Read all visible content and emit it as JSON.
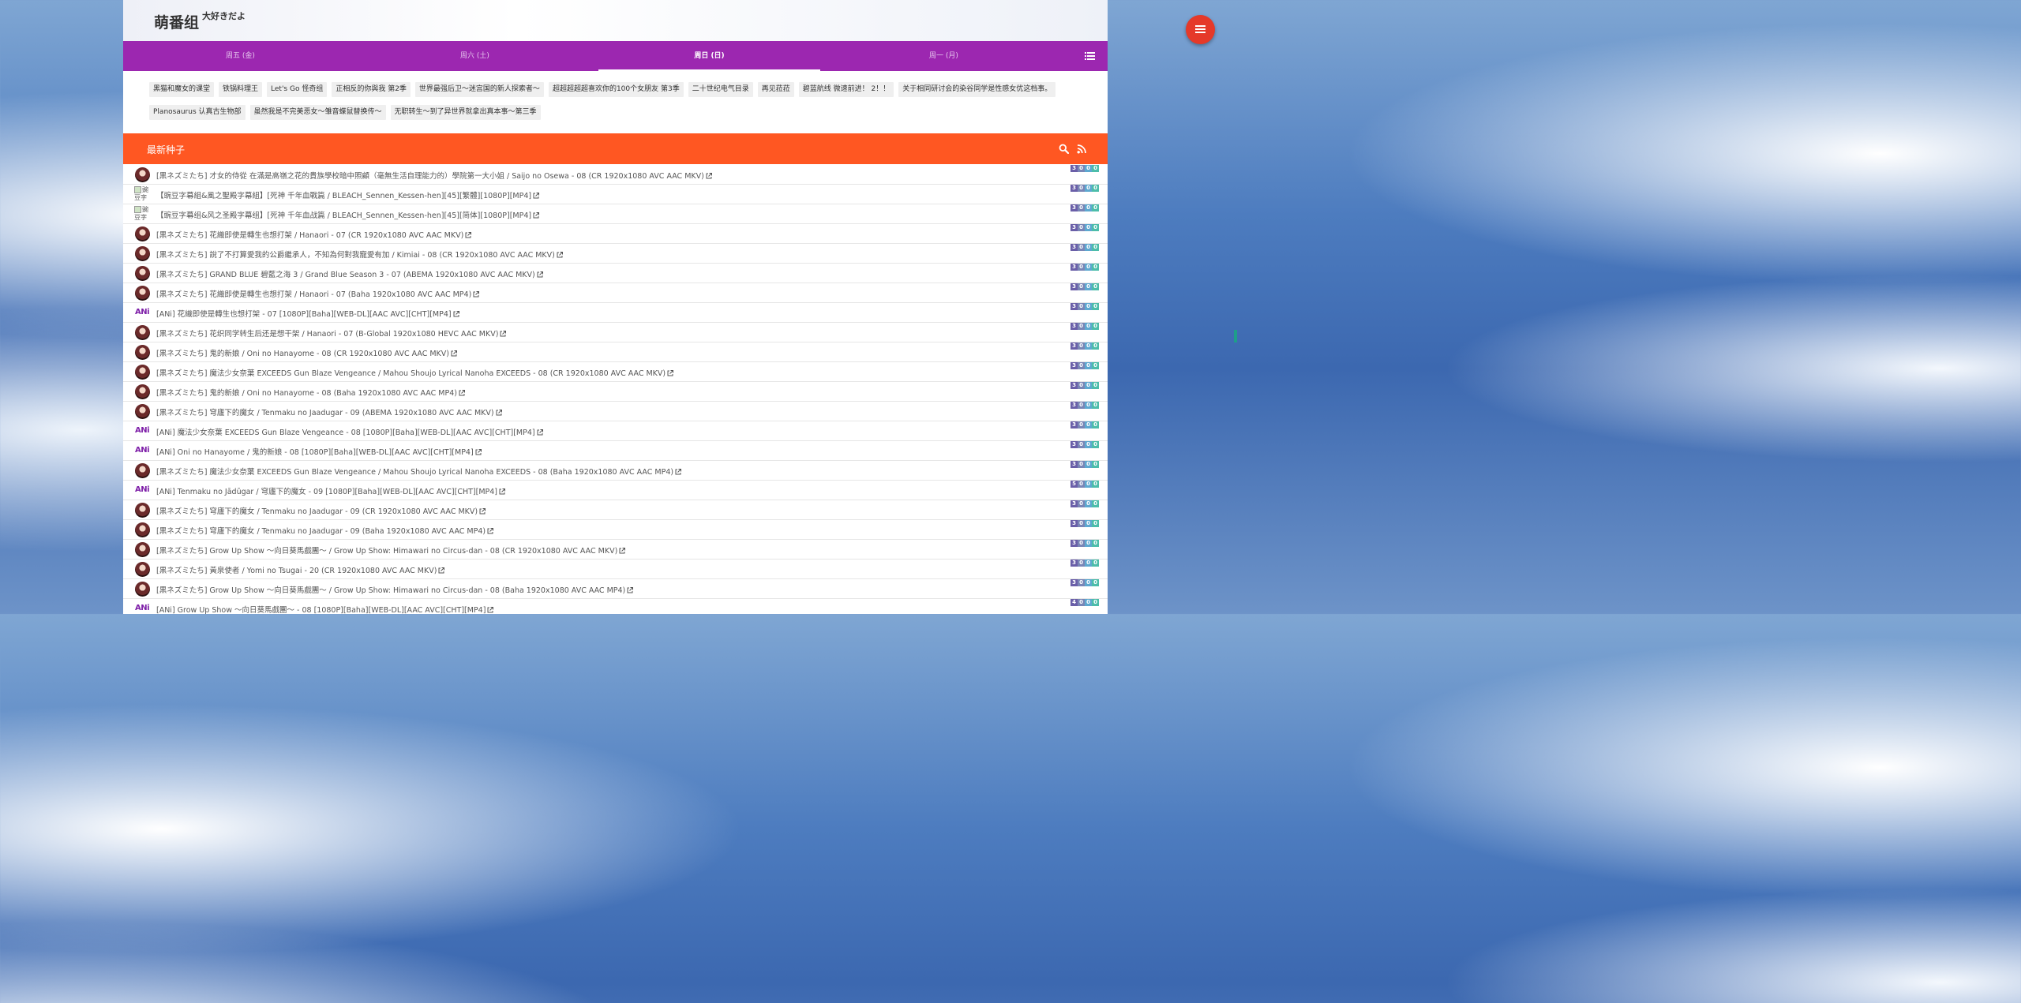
{
  "site": {
    "title": "萌番组",
    "subtitle": "大好きだよ"
  },
  "day_tabs": [
    {
      "label": "周五 (金)"
    },
    {
      "label": "周六 (土)"
    },
    {
      "label": "周日 (日)",
      "active": true
    },
    {
      "label": "周一 (月)"
    }
  ],
  "tabs_menu_icon": "list-icon",
  "fab_icon": "menu-icon",
  "colors": {
    "tabs_bar": "#9c27b0",
    "torrents_header": "#ff5722",
    "fab": "#e53929",
    "ani_label": "#7e1fa8"
  },
  "bangumi_tags": [
    "黑猫和魔女的课堂",
    "铁锅料理王",
    "Let's Go 怪奇组",
    "正相反的你與我 第2季",
    "世界最强后卫～迷宫国的新人探索者～",
    "超超超超超喜欢你的100个女朋友 第3季",
    "二十世纪电气目录",
    "再见菈菈",
    "碧蓝航线 微速前进！ 2！！",
    "关于相同研讨会的染谷同学是性感女优这档事。",
    "Planosaurus 认真古生物部",
    "虽然我是不完美恶女～雏音蝶鼠替换传～",
    "无职转生～到了异世界就拿出真本事～第三季"
  ],
  "torrents": {
    "heading": "最新种子",
    "search_icon": "search-icon",
    "rss_icon": "rss-icon",
    "items": [
      {
        "team": "kurone",
        "broken_alt": "",
        "title": "[黒ネズミたち] 才女的侍從 在滿是高嶺之花的貴族學校暗中照顧（毫無生活自理能力的）學院第一大小姐 / Saijo no Osewa - 08 (CR 1920x1080 AVC AAC MKV)",
        "counts": [
          "3",
          "0",
          "0",
          "0"
        ]
      },
      {
        "team": "broken",
        "broken_alt": "豌豆字",
        "title": "【豌豆字幕組&風之聖殿字幕組】[死神 千年血戰篇 / BLEACH_Sennen_Kessen-hen][45][繁體][1080P][MP4]",
        "counts": [
          "3",
          "0",
          "0",
          "0"
        ]
      },
      {
        "team": "broken",
        "broken_alt": "豌豆字",
        "title": "【豌豆字幕组&风之圣殿字幕组】[死神 千年血战篇 / BLEACH_Sennen_Kessen-hen][45][简体][1080P][MP4]",
        "counts": [
          "3",
          "0",
          "0",
          "0"
        ]
      },
      {
        "team": "kurone",
        "broken_alt": "",
        "title": "[黒ネズミたち] 花織即使是轉生也想打架 / Hanaori - 07 (CR 1920x1080 AVC AAC MKV)",
        "counts": [
          "3",
          "0",
          "0",
          "0"
        ]
      },
      {
        "team": "kurone",
        "broken_alt": "",
        "title": "[黒ネズミたち] 說了不打算愛我的公爵繼承人，不知為何對我寵愛有加 / Kimiai - 08 (CR 1920x1080 AVC AAC MKV)",
        "counts": [
          "3",
          "0",
          "0",
          "0"
        ]
      },
      {
        "team": "kurone",
        "broken_alt": "",
        "title": "[黒ネズミたち] GRAND BLUE 碧藍之海 3 / Grand Blue Season 3 - 07 (ABEMA 1920x1080 AVC AAC MKV)",
        "counts": [
          "3",
          "0",
          "0",
          "0"
        ]
      },
      {
        "team": "kurone",
        "broken_alt": "",
        "title": "[黒ネズミたち] 花織即使是轉生也想打架 / Hanaori - 07 (Baha 1920x1080 AVC AAC MP4)",
        "counts": [
          "3",
          "0",
          "0",
          "0"
        ]
      },
      {
        "team": "ani",
        "broken_alt": "",
        "title": "[ANi] 花織即使是轉生也想打架 - 07 [1080P][Baha][WEB-DL][AAC AVC][CHT][MP4]",
        "counts": [
          "3",
          "0",
          "0",
          "0"
        ]
      },
      {
        "team": "kurone",
        "broken_alt": "",
        "title": "[黒ネズミたち] 花织同学转生后还是想干架 / Hanaori - 07 (B-Global 1920x1080 HEVC AAC MKV)",
        "counts": [
          "3",
          "0",
          "0",
          "0"
        ]
      },
      {
        "team": "kurone",
        "broken_alt": "",
        "title": "[黒ネズミたち] 鬼的新娘 / Oni no Hanayome - 08 (CR 1920x1080 AVC AAC MKV)",
        "counts": [
          "3",
          "0",
          "0",
          "0"
        ]
      },
      {
        "team": "kurone",
        "broken_alt": "",
        "title": "[黒ネズミたち] 魔法少女奈葉 EXCEEDS Gun Blaze Vengeance / Mahou Shoujo Lyrical Nanoha EXCEEDS - 08 (CR 1920x1080 AVC AAC MKV)",
        "counts": [
          "3",
          "0",
          "0",
          "0"
        ]
      },
      {
        "team": "kurone",
        "broken_alt": "",
        "title": "[黒ネズミたち] 鬼的新娘 / Oni no Hanayome - 08 (Baha 1920x1080 AVC AAC MP4)",
        "counts": [
          "3",
          "0",
          "0",
          "0"
        ]
      },
      {
        "team": "kurone",
        "broken_alt": "",
        "title": "[黒ネズミたち] 穹廬下的魔女 / Tenmaku no Jaadugar - 09 (ABEMA 1920x1080 AVC AAC MKV)",
        "counts": [
          "3",
          "0",
          "0",
          "0"
        ]
      },
      {
        "team": "ani",
        "broken_alt": "",
        "title": "[ANi] 魔法少女奈葉 EXCEEDS Gun Blaze Vengeance - 08 [1080P][Baha][WEB-DL][AAC AVC][CHT][MP4]",
        "counts": [
          "3",
          "0",
          "0",
          "0"
        ]
      },
      {
        "team": "ani",
        "broken_alt": "",
        "title": "[ANi] Oni no Hanayome / 鬼的新娘 - 08 [1080P][Baha][WEB-DL][AAC AVC][CHT][MP4]",
        "counts": [
          "3",
          "0",
          "0",
          "0"
        ]
      },
      {
        "team": "kurone",
        "broken_alt": "",
        "title": "[黒ネズミたち] 魔法少女奈葉 EXCEEDS Gun Blaze Vengeance / Mahou Shoujo Lyrical Nanoha EXCEEDS - 08 (Baha 1920x1080 AVC AAC MP4)",
        "counts": [
          "3",
          "0",
          "0",
          "0"
        ]
      },
      {
        "team": "ani",
        "broken_alt": "",
        "title": "[ANi] Tenmaku no Jādūgar / 穹廬下的魔女 - 09 [1080P][Baha][WEB-DL][AAC AVC][CHT][MP4]",
        "counts": [
          "5",
          "0",
          "0",
          "0"
        ]
      },
      {
        "team": "kurone",
        "broken_alt": "",
        "title": "[黒ネズミたち] 穹廬下的魔女 / Tenmaku no Jaadugar - 09 (CR 1920x1080 AVC AAC MKV)",
        "counts": [
          "3",
          "0",
          "0",
          "0"
        ]
      },
      {
        "team": "kurone",
        "broken_alt": "",
        "title": "[黒ネズミたち] 穹廬下的魔女 / Tenmaku no Jaadugar - 09 (Baha 1920x1080 AVC AAC MP4)",
        "counts": [
          "3",
          "0",
          "0",
          "0"
        ]
      },
      {
        "team": "kurone",
        "broken_alt": "",
        "title": "[黒ネズミたち] Grow Up Show ～向日葵馬戲團～ / Grow Up Show: Himawari no Circus-dan - 08 (CR 1920x1080 AVC AAC MKV)",
        "counts": [
          "3",
          "0",
          "0",
          "0"
        ]
      },
      {
        "team": "kurone",
        "broken_alt": "",
        "title": "[黒ネズミたち] 黃泉使者 / Yomi no Tsugai - 20 (CR 1920x1080 AVC AAC MKV)",
        "counts": [
          "3",
          "0",
          "0",
          "0"
        ]
      },
      {
        "team": "kurone",
        "broken_alt": "",
        "title": "[黒ネズミたち] Grow Up Show ～向日葵馬戲團～ / Grow Up Show: Himawari no Circus-dan - 08 (Baha 1920x1080 AVC AAC MP4)",
        "counts": [
          "3",
          "0",
          "0",
          "0"
        ]
      },
      {
        "team": "ani",
        "broken_alt": "",
        "title": "[ANi] Grow Up Show ～向日葵馬戲團～ - 08 [1080P][Baha][WEB-DL][AAC AVC][CHT][MP4]",
        "counts": [
          "4",
          "0",
          "0",
          "0"
        ]
      }
    ]
  }
}
